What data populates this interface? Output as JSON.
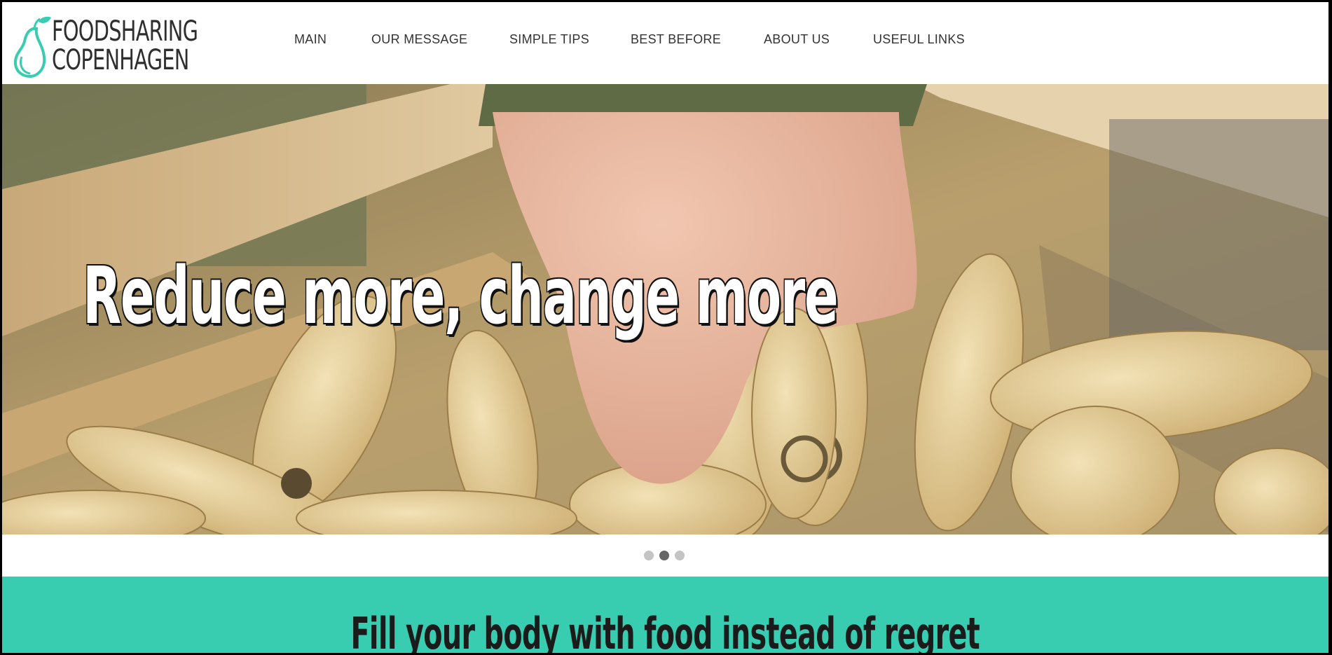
{
  "logo": {
    "line1": "FOODSHARING",
    "line2": "COPENHAGEN",
    "icon": "pear-icon",
    "accent": "#38ccb0"
  },
  "nav": {
    "items": [
      {
        "label": "MAIN"
      },
      {
        "label": "OUR MESSAGE"
      },
      {
        "label": "SIMPLE TIPS"
      },
      {
        "label": "BEST BEFORE"
      },
      {
        "label": "ABOUT US"
      },
      {
        "label": "USEFUL LINKS"
      }
    ]
  },
  "hero": {
    "title": "Reduce more, change more",
    "image": "hand picking parsnips from a wooden crate"
  },
  "carousel": {
    "slide_count": 3,
    "active_slide": 2
  },
  "banner": {
    "text": "Fill your body with food instead of regret",
    "color": "#38ccb0"
  }
}
